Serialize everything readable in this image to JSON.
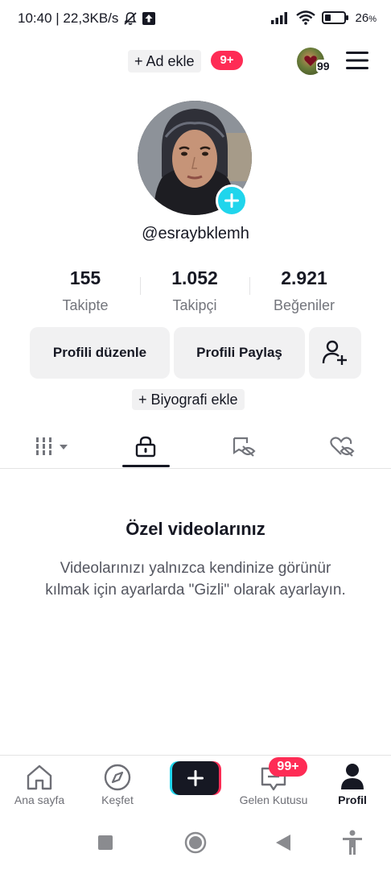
{
  "status_bar": {
    "time_speed": "10:40 | 22,3KB/s",
    "battery": "26"
  },
  "top_bar": {
    "add_account": "+ Ad ekle",
    "notification_count": "9+",
    "account_count": "99",
    "icons": [
      "dnd-icon",
      "upload-icon",
      "signal-icon",
      "wifi-icon",
      "battery-icon",
      "menu-icon"
    ]
  },
  "profile": {
    "username": "@esraybklemh",
    "stats": [
      {
        "value": "155",
        "label": "Takipte"
      },
      {
        "value": "1.052",
        "label": "Takipçi"
      },
      {
        "value": "2.921",
        "label": "Beğeniler"
      }
    ],
    "edit_profile": "Profili düzenle",
    "share_profile": "Profili Paylaş",
    "add_bio": "+ Biyografi ekle"
  },
  "tabs": [
    {
      "name": "videos-grid",
      "icon": "grid-icon"
    },
    {
      "name": "private",
      "icon": "lock-icon",
      "active": true
    },
    {
      "name": "reposts",
      "icon": "repost-hidden-icon"
    },
    {
      "name": "liked",
      "icon": "liked-hidden-icon"
    }
  ],
  "empty_state": {
    "title": "Özel videolarınız",
    "description": "Videolarınızı yalnızca kendinize görünür kılmak için ayarlarda \"Gizli\" olarak ayarlayın."
  },
  "bottom_nav": {
    "items": [
      {
        "label": "Ana sayfa",
        "icon": "home-icon"
      },
      {
        "label": "Keşfet",
        "icon": "compass-icon"
      },
      {
        "label": "",
        "icon": "plus-icon"
      },
      {
        "label": "Gelen Kutusu",
        "icon": "inbox-icon"
      },
      {
        "label": "Profil",
        "icon": "person-icon"
      }
    ],
    "inbox_badge": "99+"
  },
  "colors": {
    "accent_red": "#fe2c55",
    "accent_cyan": "#20d5ec",
    "text_primary": "#161823",
    "text_secondary": "#73757c"
  }
}
